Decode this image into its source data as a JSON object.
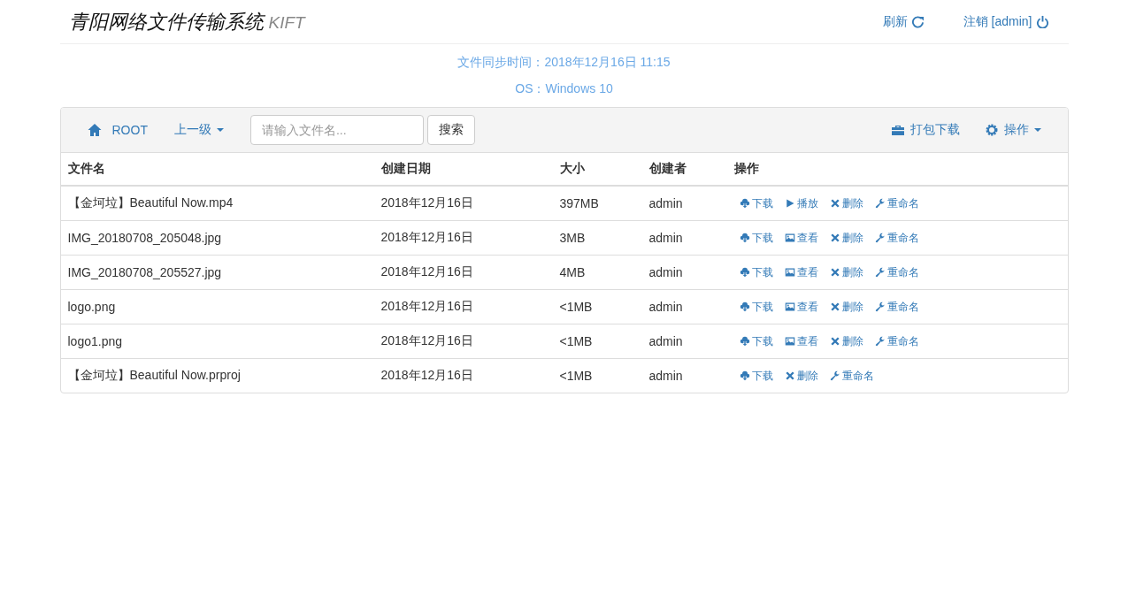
{
  "header": {
    "title": "青阳网络文件传输系统",
    "subtitle": "KIFT",
    "links": [
      {
        "label": "刷新",
        "kind": "refresh"
      },
      {
        "label": "注销 [admin]",
        "kind": "logout"
      }
    ]
  },
  "info": [
    "文件同步时间：2018年12月16日 11:15",
    "OS：Windows 10"
  ],
  "toolbar": {
    "root": "ROOT",
    "parent": "上一级",
    "search": {
      "placeholder": "请输入文件名..."
    },
    "search_button": "搜索",
    "pack_download": "打包下载",
    "actions_menu": "操作"
  },
  "table": {
    "columns": [
      "文件名",
      "创建日期",
      "大小",
      "创建者",
      "操作"
    ],
    "rows": [
      {
        "name": "【金坷垃】Beautiful Now.mp4",
        "date": "2018年12月16日",
        "size": "397MB",
        "creator": "admin",
        "actions": [
          {
            "kind": "download",
            "label": "下载"
          },
          {
            "kind": "play",
            "label": "播放"
          },
          {
            "kind": "delete",
            "label": "删除"
          },
          {
            "kind": "rename",
            "label": "重命名"
          }
        ]
      },
      {
        "name": "IMG_20180708_205048.jpg",
        "date": "2018年12月16日",
        "size": "3MB",
        "creator": "admin",
        "actions": [
          {
            "kind": "download",
            "label": "下载"
          },
          {
            "kind": "view",
            "label": "查看"
          },
          {
            "kind": "delete",
            "label": "删除"
          },
          {
            "kind": "rename",
            "label": "重命名"
          }
        ]
      },
      {
        "name": "IMG_20180708_205527.jpg",
        "date": "2018年12月16日",
        "size": "4MB",
        "creator": "admin",
        "actions": [
          {
            "kind": "download",
            "label": "下载"
          },
          {
            "kind": "view",
            "label": "查看"
          },
          {
            "kind": "delete",
            "label": "删除"
          },
          {
            "kind": "rename",
            "label": "重命名"
          }
        ]
      },
      {
        "name": "logo.png",
        "date": "2018年12月16日",
        "size": "<1MB",
        "creator": "admin",
        "actions": [
          {
            "kind": "download",
            "label": "下载"
          },
          {
            "kind": "view",
            "label": "查看"
          },
          {
            "kind": "delete",
            "label": "删除"
          },
          {
            "kind": "rename",
            "label": "重命名"
          }
        ]
      },
      {
        "name": "logo1.png",
        "date": "2018年12月16日",
        "size": "<1MB",
        "creator": "admin",
        "actions": [
          {
            "kind": "download",
            "label": "下载"
          },
          {
            "kind": "view",
            "label": "查看"
          },
          {
            "kind": "delete",
            "label": "删除"
          },
          {
            "kind": "rename",
            "label": "重命名"
          }
        ]
      },
      {
        "name": "【金坷垃】Beautiful Now.prproj",
        "date": "2018年12月16日",
        "size": "<1MB",
        "creator": "admin",
        "actions": [
          {
            "kind": "download",
            "label": "下载"
          },
          {
            "kind": "delete",
            "label": "删除"
          },
          {
            "kind": "rename",
            "label": "重命名"
          }
        ]
      }
    ]
  }
}
